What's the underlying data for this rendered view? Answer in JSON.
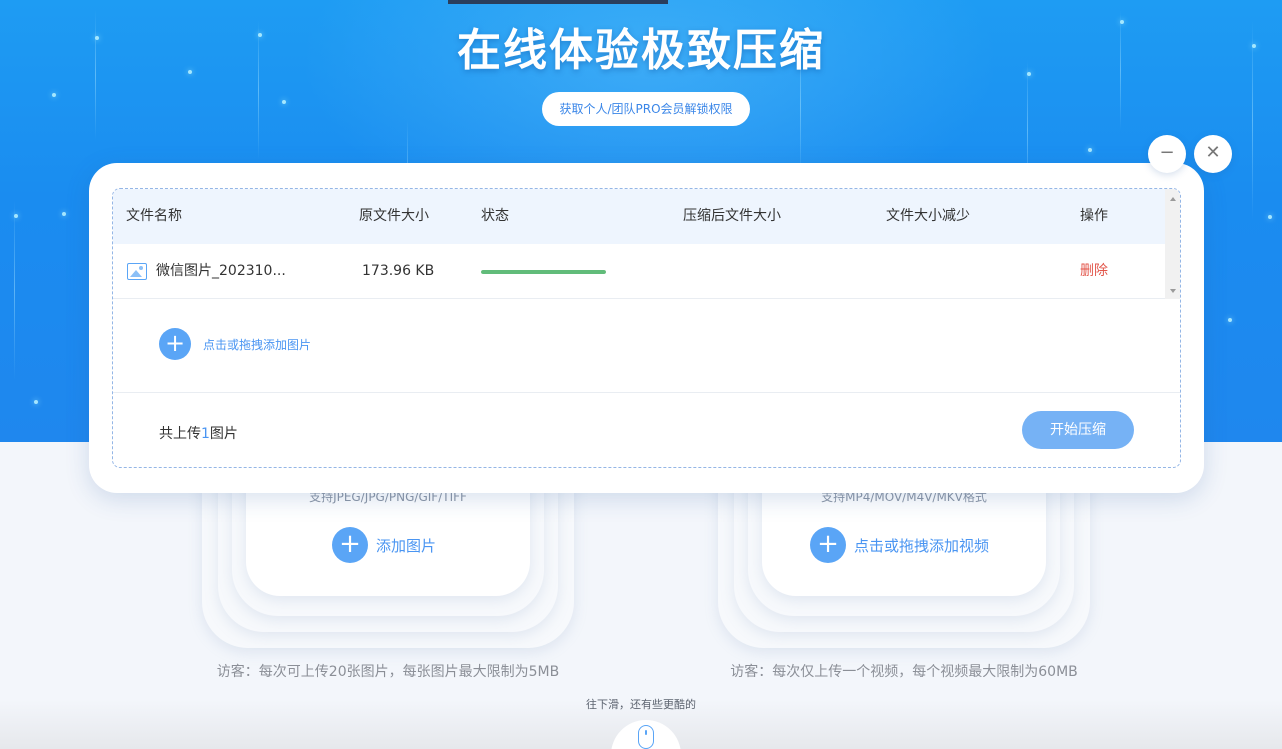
{
  "hero": {
    "title": "在线体验极致压缩",
    "pro_link": "获取个人/团队PRO会员解锁权限"
  },
  "window_controls": {
    "minimize_icon": "minimize-icon",
    "close_icon": "close-icon"
  },
  "table": {
    "headers": [
      "文件名称",
      "原文件大小",
      "状态",
      "压缩后文件大小",
      "文件大小减少",
      "操作"
    ],
    "rows": [
      {
        "file_name": "微信图片_202310...",
        "original_size": "173.96 KB",
        "progress": 1.0,
        "compressed_size": "",
        "reduction": "",
        "action": "删除"
      }
    ]
  },
  "add_images": {
    "label": "点击或拖拽添加图片"
  },
  "footer": {
    "count_prefix": "共上传",
    "count": "1",
    "count_suffix": "图片",
    "start_button": "开始压缩"
  },
  "cards": {
    "image": {
      "formats": "支持JPEG/JPG/PNG/GIF/TIFF",
      "add_label": "添加图片",
      "visitor_note": "访客：每次可上传20张图片，每张图片最大限制为5MB"
    },
    "video": {
      "formats": "支持MP4/MOV/M4V/MKV格式",
      "add_label": "点击或拖拽添加视频",
      "visitor_note": "访客：每次仅上传一个视频，每个视频最大限制为60MB"
    }
  },
  "scroll_hint": "往下滑，还有些更酷的",
  "colors": {
    "accent": "#4a95f2",
    "progress": "#61bc7a",
    "delete": "#e2554a",
    "hero": "#1a8cf0"
  }
}
